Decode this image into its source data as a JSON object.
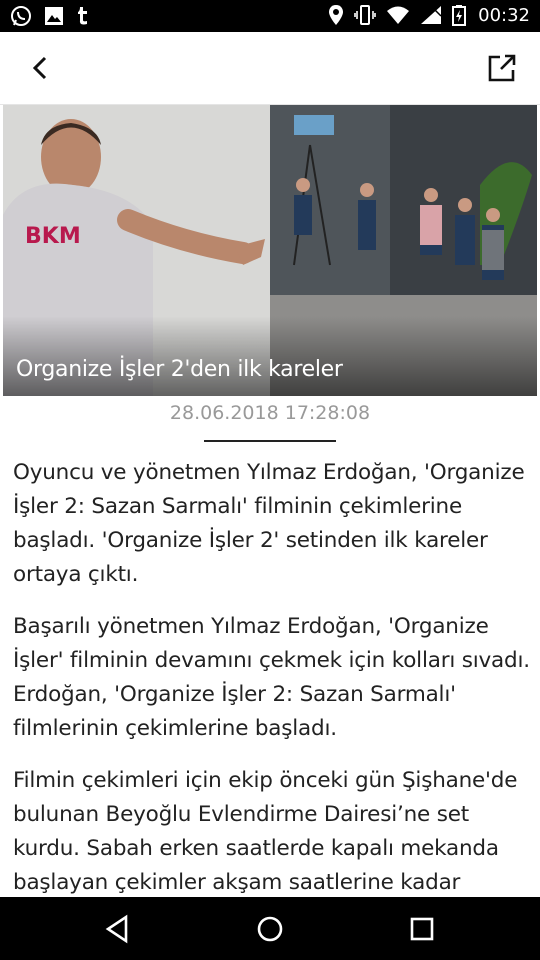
{
  "status_bar": {
    "time": "00:32"
  },
  "toolbar": {
    "back_icon": "chevron-left-icon",
    "share_icon": "open-external-icon"
  },
  "hero": {
    "caption": "Organize İşler 2'den ilk kareler"
  },
  "article": {
    "date": "28.06.2018 17:28:08",
    "paragraphs": [
      "Oyuncu ve yönetmen Yılmaz Erdoğan, 'Organize İşler 2: Sazan Sarmalı' filminin çekimlerine başladı. 'Organize İşler 2' setinden ilk kareler ortaya çıktı.",
      "Başarılı yönetmen Yılmaz Erdoğan, 'Organize İşler' filminin devamını çekmek için kolları sıvadı. Erdoğan, 'Organize İşler 2: Sazan Sarmalı' filmlerinin çekimlerine başladı.",
      "Filmin çekimleri için ekip önceki gün Şişhane'de bulunan Beyoğlu Evlendirme Dairesi’ne set kurdu. Sabah erken saatlerde kapalı mekanda başlayan çekimler akşam saatlerine kadar"
    ]
  }
}
